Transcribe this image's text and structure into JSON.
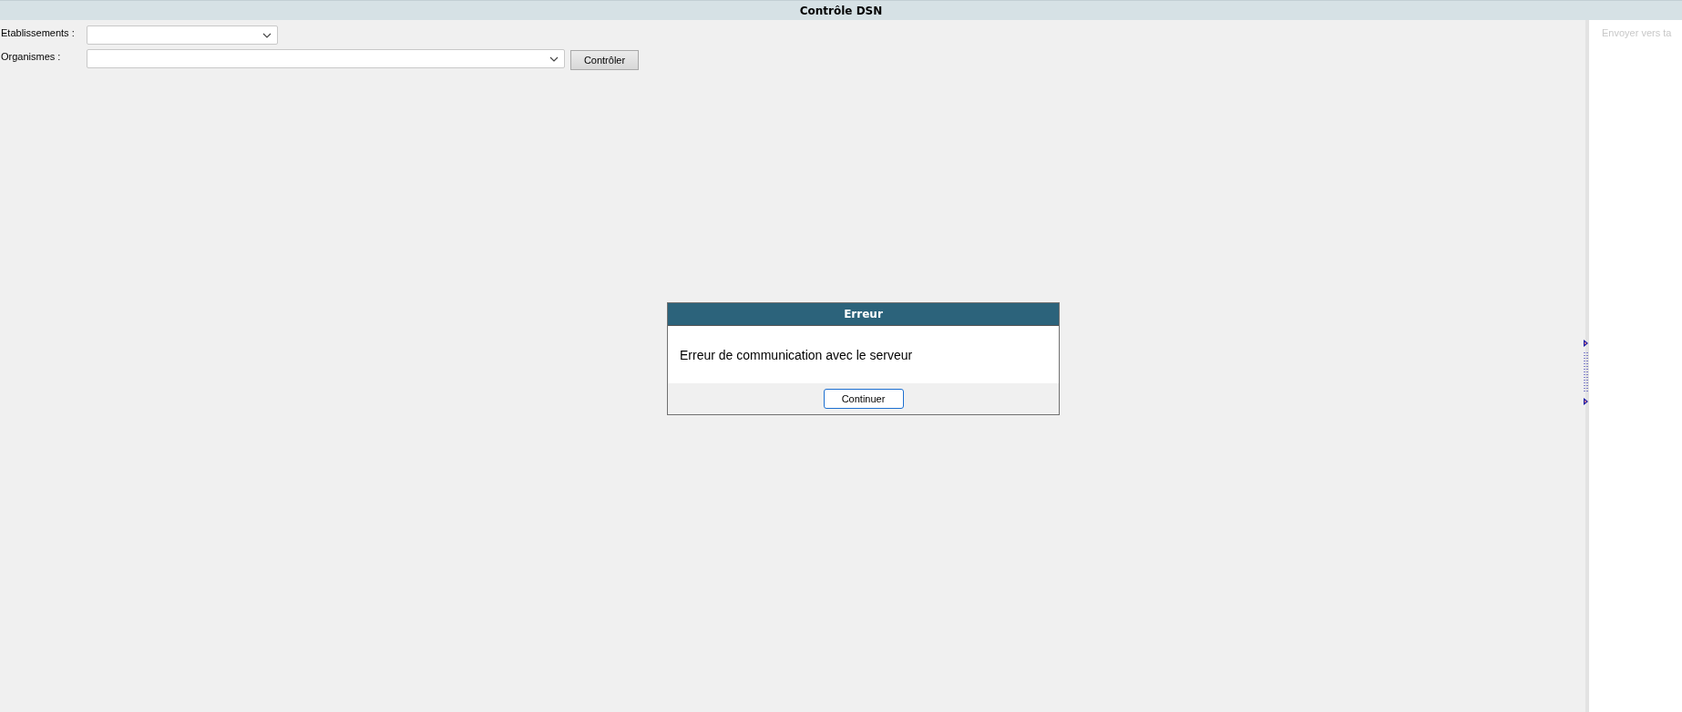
{
  "window": {
    "title": "Contrôle DSN"
  },
  "filters": [
    {
      "label": "Etablissements :",
      "kind": "short"
    },
    {
      "label": "Organismes :",
      "kind": "wide"
    }
  ],
  "check_button": "Contrôler",
  "side_panel": {
    "text": "Envoyer vers ta"
  },
  "dialog": {
    "title": "Erreur",
    "message": "Erreur de communication avec le serveur",
    "button": "Continuer"
  }
}
